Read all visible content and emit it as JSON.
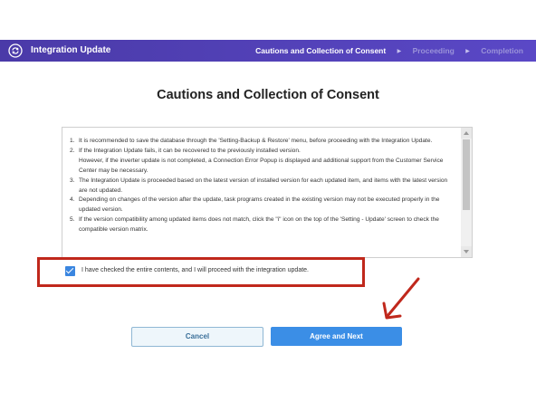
{
  "header": {
    "title": "Integration Update",
    "icon": "sync-icon",
    "steps": [
      {
        "label": "Cautions and Collection of Consent",
        "state": "active"
      },
      {
        "label": "Proceeding",
        "state": "inactive"
      },
      {
        "label": "Completion",
        "state": "inactive"
      }
    ]
  },
  "page": {
    "title": "Cautions and Collection of Consent"
  },
  "cautions": [
    {
      "num": "1.",
      "text": "It is recommended to save the database through the 'Setting-Backup & Restore' menu, before proceeding with the Integration Update."
    },
    {
      "num": "2.",
      "text": "If the Integration Update fails, it can be recovered to the previously installed version."
    },
    {
      "num": "",
      "text": "However, if the inverter update is not completed, a Connection Error Popup is displayed and additional support from the Customer Service Center may be necessary."
    },
    {
      "num": "3.",
      "text": "The Integration Update is proceeded based on the latest version of installed version for each updated item, and items with the latest version are not updated."
    },
    {
      "num": "4.",
      "text": "Depending on changes of the version after the update, task programs created in the existing version may not be executed properly in the updated version."
    },
    {
      "num": "5.",
      "text": "If the version compatibility among updated items does not match, click the \"i\" icon on the top of the 'Setting - Update' screen to check the compatible version matrix."
    }
  ],
  "consent": {
    "label": "I have checked the entire contents, and I will proceed with the integration update.",
    "checked": true
  },
  "buttons": {
    "cancel": "Cancel",
    "next": "Agree and Next"
  },
  "colors": {
    "header": "#5040b8",
    "primary_button": "#3b8ee6",
    "highlight": "#c0281c"
  }
}
